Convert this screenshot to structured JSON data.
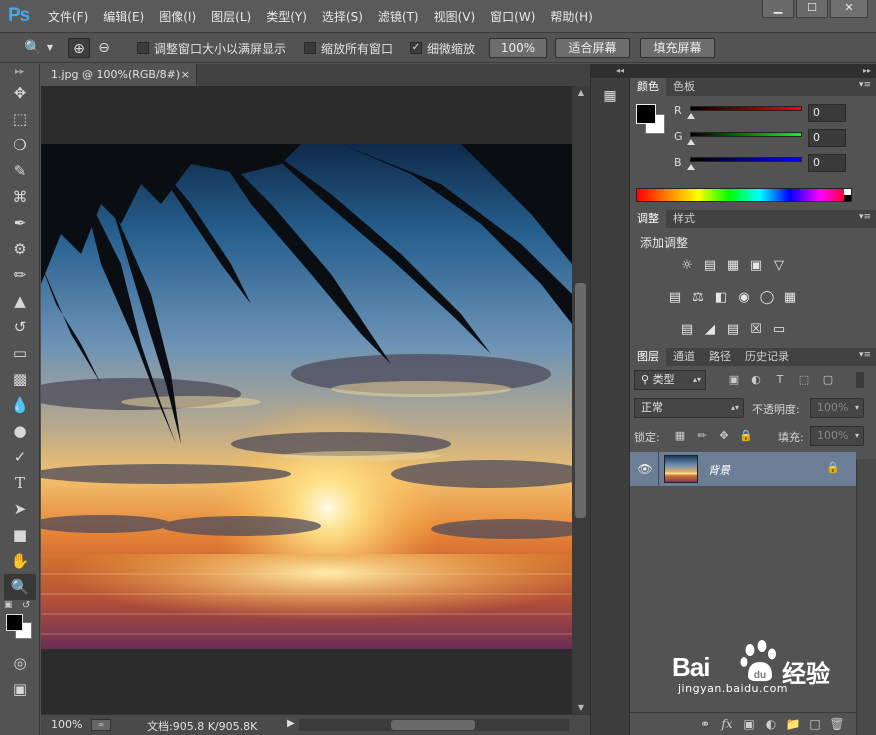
{
  "app": {
    "logo": "Ps",
    "menu": [
      "文件(F)",
      "编辑(E)",
      "图像(I)",
      "图层(L)",
      "类型(Y)",
      "选择(S)",
      "滤镜(T)",
      "视图(V)",
      "窗口(W)",
      "帮助(H)"
    ],
    "window_controls": {
      "minimize": "▁",
      "maximize": "☐",
      "close": "✕"
    }
  },
  "options": {
    "tool_icon": "zoom-icon",
    "resize_windows_label": "调整窗口大小以满屏显示",
    "resize_windows_checked": false,
    "zoom_all_label": "缩放所有窗口",
    "zoom_all_checked": false,
    "scrubby_zoom_label": "细微缩放",
    "scrubby_zoom_checked": true,
    "btn_100": "100%",
    "btn_fit": "适合屏幕",
    "btn_fill": "填充屏幕"
  },
  "document": {
    "tab_title": "1.jpg @ 100%(RGB/8#)",
    "tab_close": "×",
    "zoom_level": "100%",
    "doc_size": "文档:905.8 K/905.8K"
  },
  "color_panel": {
    "tabs": [
      "颜色",
      "色板"
    ],
    "channels": [
      {
        "label": "R",
        "value": "0",
        "gradient_end": "#ff0000"
      },
      {
        "label": "G",
        "value": "0",
        "gradient_end": "#00ff00"
      },
      {
        "label": "B",
        "value": "0",
        "gradient_end": "#0000ff"
      }
    ],
    "foreground": "#000000",
    "background": "#ffffff"
  },
  "adjustments_panel": {
    "tabs": [
      "调整",
      "样式"
    ],
    "title": "添加调整",
    "row1_icons": [
      "brightness-icon",
      "levels-icon",
      "curves-icon",
      "exposure-icon",
      "vibrance-icon"
    ],
    "row2_icons": [
      "hue-saturation-icon",
      "color-balance-icon",
      "black-white-icon",
      "photo-filter-icon",
      "channel-mixer-icon",
      "color-lookup-icon"
    ],
    "row3_icons": [
      "invert-icon",
      "posterize-icon",
      "threshold-icon",
      "selective-color-icon",
      "gradient-map-icon"
    ]
  },
  "layers_panel": {
    "tabs": [
      "图层",
      "通道",
      "路径",
      "历史记录"
    ],
    "filter_kind": "类型",
    "blend_mode": "正常",
    "opacity_label": "不透明度:",
    "opacity_value": "100%",
    "lock_label": "锁定:",
    "fill_label": "填充:",
    "fill_value": "100%",
    "layers": [
      {
        "name": "背景",
        "visible": true,
        "locked": true
      }
    ]
  },
  "watermark": {
    "brand": "Bai",
    "brand_suffix": "du",
    "product": "经验",
    "url": "jingyan.baidu.com"
  }
}
